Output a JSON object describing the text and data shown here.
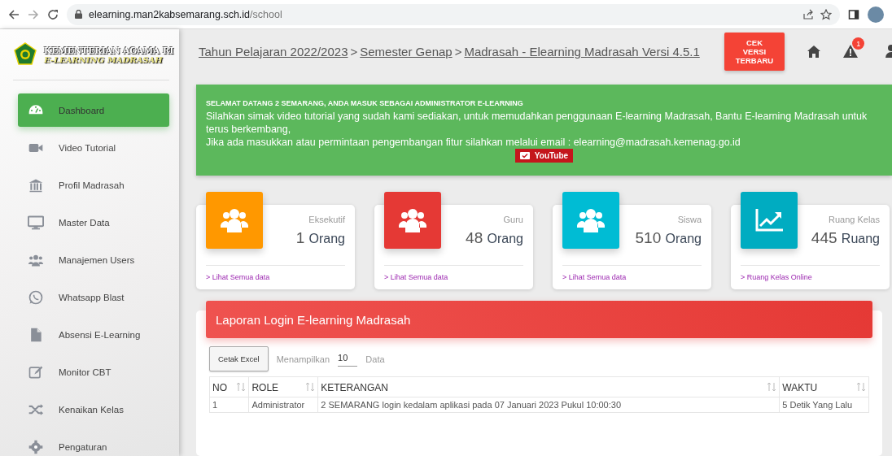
{
  "browser": {
    "url_host": "elearning.man2kabsemarang.sch.id",
    "url_path": "/school"
  },
  "sidebar": {
    "logo_title": "KEMENTERIAN AGAMA RI",
    "logo_subtitle": "E-LEARNING MADRASAH",
    "items": [
      {
        "label": "Dashboard",
        "selected": true
      },
      {
        "label": "Video Tutorial",
        "selected": false
      },
      {
        "label": "Profil Madrasah",
        "selected": false
      },
      {
        "label": "Master Data",
        "selected": false
      },
      {
        "label": "Manajemen Users",
        "selected": false
      },
      {
        "label": "Whatsapp Blast",
        "selected": false
      },
      {
        "label": "Absensi E-Learning",
        "selected": false
      },
      {
        "label": "Monitor CBT",
        "selected": false
      },
      {
        "label": "Kenaikan Kelas",
        "selected": false
      },
      {
        "label": "Pengaturan",
        "selected": false
      }
    ]
  },
  "header": {
    "breadcrumb": [
      "Tahun Pelajaran 2022/2023",
      "Semester Genap",
      "Madrasah - Elearning Madrasah Versi 4.5.1"
    ],
    "separator": ">",
    "button": "CEK VERSI TERBARU",
    "notification_count": "1"
  },
  "banner": {
    "title": "SELAMAT DATANG 2 SEMARANG, ANDA MASUK SEBAGAI ADMINISTRATOR E-LEARNING",
    "lines": [
      "Silahkan simak video tutorial yang sudah kami sediakan, untuk memudahkan penggunaan E-learning Madrasah, Bantu E-learning Madrasah untuk terus berkembang,",
      "Jika ada masukkan atau permintaan pengembangan fitur silahkan melalui email : elearning@madrasah.kemenag.go.id"
    ],
    "button": "YouTube"
  },
  "stats": [
    {
      "kind": "people",
      "color": "#ff9800",
      "label": "Eksekutif",
      "value": "1",
      "unit": "Orang",
      "link": "> Lihat Semua data"
    },
    {
      "kind": "people",
      "color": "#e53935",
      "label": "Guru",
      "value": "48",
      "unit": "Orang",
      "link": "> Lihat Semua data"
    },
    {
      "kind": "people",
      "color": "#00bcd4",
      "label": "Siswa",
      "value": "510",
      "unit": "Orang",
      "link": "> Lihat Semua data"
    },
    {
      "kind": "chart",
      "color": "#00acc1",
      "label": "Ruang Kelas",
      "value": "445",
      "unit": "Ruang",
      "link": "> Ruang Kelas Online"
    }
  ],
  "report": {
    "title": "Laporan Login E-learning Madrasah",
    "export_button": "Cetak Excel",
    "show_label": "Menampilkan",
    "show_value": "10",
    "show_suffix": "Data",
    "columns": [
      "NO",
      "ROLE",
      "KETERANGAN",
      "WAKTU"
    ],
    "rows": [
      [
        "1",
        "Administrator",
        "2 SEMARANG login kedalam aplikasi pada 07 Januari 2023 Pukul 10:00:30",
        "5 Detik Yang Lalu"
      ]
    ]
  }
}
